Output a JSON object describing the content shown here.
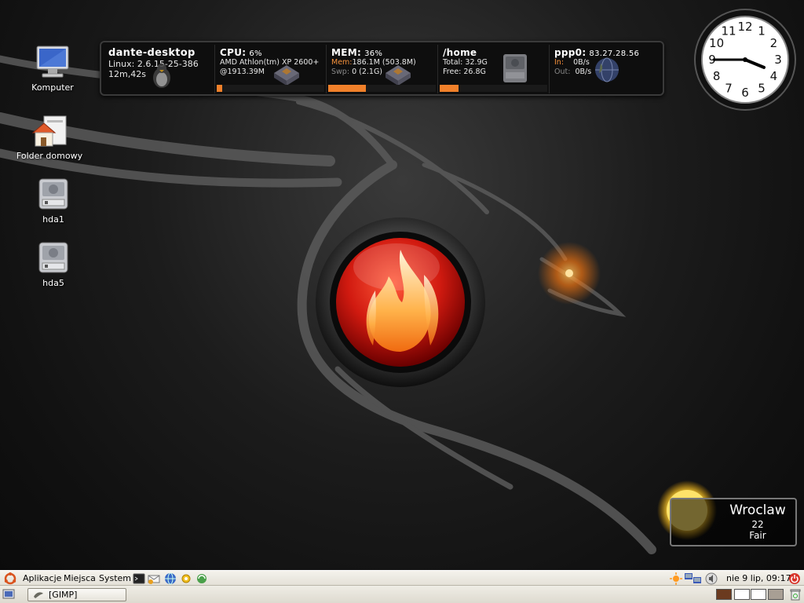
{
  "desktop_icons": [
    {
      "label": "Komputer",
      "icon": "computer-icon"
    },
    {
      "label": "Folder domowy",
      "icon": "home-folder-icon"
    },
    {
      "label": "hda1",
      "icon": "harddisk-icon"
    },
    {
      "label": "hda5",
      "icon": "harddisk-icon"
    }
  ],
  "sysmon": {
    "host": {
      "name": "dante-desktop",
      "kernel": "Linux: 2.6.15-25-386",
      "uptime": "12m,42s"
    },
    "cpu": {
      "title": "CPU:",
      "percent": "6%",
      "model": "AMD Athlon(tm) XP 2600+",
      "freq": "@1913.39M",
      "load": 0.06
    },
    "mem": {
      "title": "MEM:",
      "percent": "36%",
      "mem_label": "Mem:",
      "mem_value": "186.1M (503.8M)",
      "swap_label": "Swp:",
      "swap_value": "0 (2.1G)",
      "load": 0.36
    },
    "disk": {
      "title": "/home",
      "total": "Total: 32.9G",
      "free": "Free: 26.8G",
      "load": 0.18
    },
    "net": {
      "title": "ppp0:",
      "ip": "83.27.28.56",
      "in_label": "In:",
      "in_value": "0B/s",
      "out_label": "Out:",
      "out_value": "0B/s"
    }
  },
  "clock": {
    "numerals": [
      "12",
      "1",
      "2",
      "3",
      "4",
      "5",
      "6",
      "7",
      "8",
      "9",
      "10",
      "11"
    ],
    "hour": 3,
    "minute": 45
  },
  "weather": {
    "city": "Wroclaw",
    "temperature": "22",
    "condition": "Fair",
    "icon": "sun-icon"
  },
  "top_panel": {
    "menus": [
      "Aplikacje",
      "Miejsca",
      "System"
    ],
    "launchers": [
      "terminal-icon",
      "mail-icon",
      "browser-icon",
      "settings-icon",
      "network-icon"
    ],
    "tray": [
      "weather-tray-icon",
      "network-tray-icon",
      "volume-icon"
    ],
    "datetime": "nie  9 lip, 09:17",
    "power_icon": "power-icon"
  },
  "bottom_panel": {
    "task": "[GIMP]",
    "show_desktop_icon": "show-desktop-icon",
    "trash_icon": "trash-icon",
    "workspace_colors": [
      "#6b3a1f",
      "#ffffff",
      "#ffffff",
      "#a89f94"
    ]
  }
}
